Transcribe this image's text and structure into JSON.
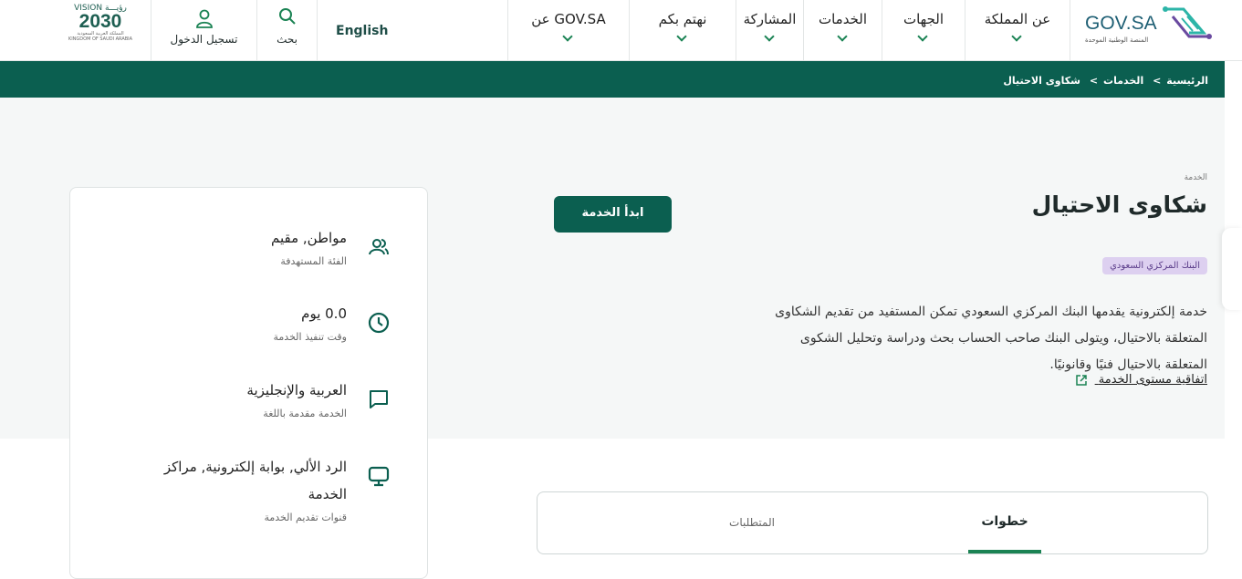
{
  "header": {
    "logo_text": "GOV.SA",
    "logo_subtitle": "المنصة الوطنية الموحدة",
    "nav": [
      {
        "label": "عن المملكة"
      },
      {
        "label": "الجهات"
      },
      {
        "label": "الخدمات"
      },
      {
        "label": "المشاركة"
      },
      {
        "label": "نهتم بكم"
      },
      {
        "label": "عن GOV.SA"
      }
    ],
    "language": "English",
    "search": "بحث",
    "login": "تسجيل الدخول",
    "vision_logo": {
      "top": "VISION رؤيـــة",
      "number": "2030",
      "sub_ar": "المملكة العربية السعودية",
      "sub_en": "KINGDOM OF SAUDI ARABIA"
    }
  },
  "breadcrumb": [
    "الرئيسية",
    "الخدمات",
    "شكاوى الاحتيال"
  ],
  "breadcrumb_separator": ">",
  "service": {
    "eyebrow": "الخدمة",
    "title": "شكاوى الاحتيال",
    "provider_badge": "البنك المركزي السعودي",
    "description": "خدمة إلكترونية يقدمها البنك المركزي السعودي تمكن المستفيد من تقديم الشكاوى المتعلقة بالاحتيال، ويتولى البنك صاحب الحساب بحث ودراسة وتحليل الشكوى المتعلقة بالاحتيال فنيًا وقانونيًا.",
    "sla_link": "اتفاقية مستوى الخدمة",
    "start_button": "ابدأ الخدمة"
  },
  "info_card": [
    {
      "icon": "users-icon",
      "value": "مواطن, مقيم",
      "label": "الفئة المستهدفة"
    },
    {
      "icon": "clock-icon",
      "value": "0.0 يوم",
      "label": "وقت تنفيذ الخدمة"
    },
    {
      "icon": "chat-icon",
      "value": "العربية والإنجليزية",
      "label": "الخدمة مقدمة باللغة"
    },
    {
      "icon": "monitor-icon",
      "value": "الرد الألي, بوابة إلكترونية, مراكز الخدمة",
      "label": "قنوات تقديم الخدمة"
    }
  ],
  "tabs": [
    {
      "label": "خطوات",
      "active": true
    },
    {
      "label": "المتطلبات",
      "active": false
    }
  ],
  "colors": {
    "primary": "#0b5f50",
    "accent": "#1b8354",
    "badge": "#ddd0f0"
  }
}
